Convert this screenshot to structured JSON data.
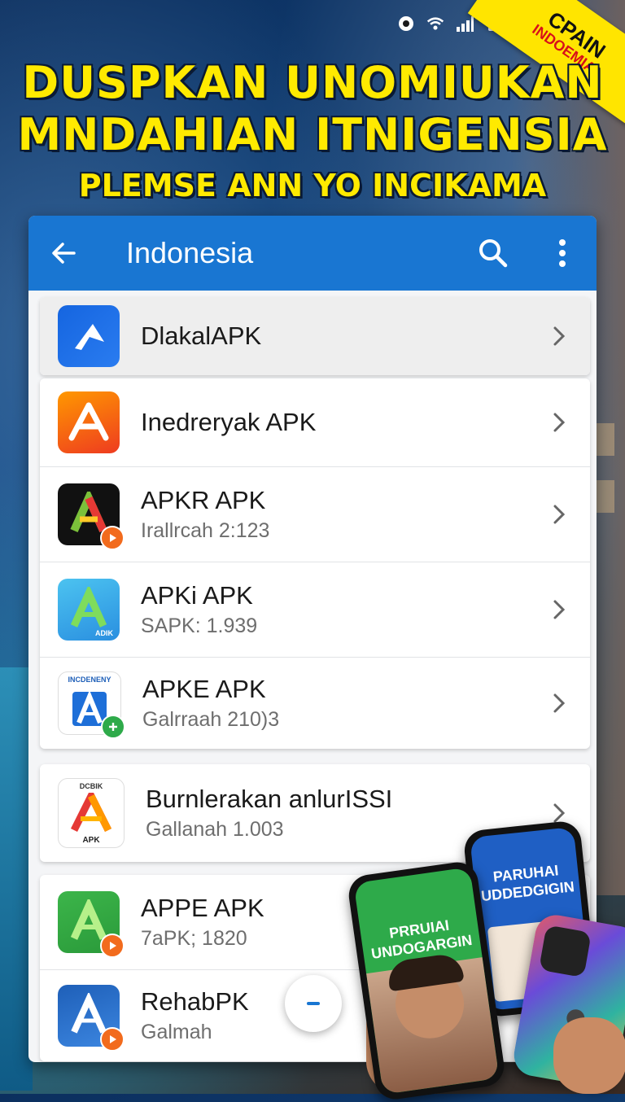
{
  "banner": {
    "corner_line1": "CPAIN",
    "corner_line2": "INDOEMIA!",
    "headline_line1": "DUSPKAN UNOMIUKAN",
    "headline_line2": "MNDAHIAN ITNIGENSIA",
    "headline_line3": "PLEMSE ANN YO INCIKAMA"
  },
  "appbar": {
    "title": "Indonesia",
    "back_icon": "arrow-left-icon",
    "search_icon": "search-icon",
    "more_icon": "more-vert-icon",
    "color": "#1976d2"
  },
  "apps": [
    {
      "name": "DlakalAPK",
      "sub": "",
      "colors": [
        "#1565e0",
        "#2a7cf0"
      ],
      "selected": true
    },
    {
      "name": "Inedreryak APK",
      "sub": "",
      "colors": [
        "#ff9800",
        "#ee3b20"
      ],
      "selected": false
    },
    {
      "name": "APKR APK",
      "sub": "Irallrcah 2:123",
      "colors": [
        "#1b1b1b",
        "#000000"
      ],
      "selected": false
    },
    {
      "name": "APKi APK",
      "sub": "SAPK: 1.939",
      "colors": [
        "#3bb3ea",
        "#2a8fe0"
      ],
      "selected": false
    },
    {
      "name": "APKE APK",
      "sub": "Galrraah 210)3",
      "colors": [
        "#ffffff",
        "#eeeeee"
      ],
      "selected": false
    },
    {
      "name": "Burnlerakan anlurISSI",
      "sub": "Gallanah 1.003",
      "colors": [
        "#ffffff",
        "#f1f1f1"
      ],
      "selected": false
    },
    {
      "name": "APPE APK",
      "sub": "7aPK; 1820",
      "colors": [
        "#3cb54a",
        "#2a9a3a"
      ],
      "selected": false
    },
    {
      "name": "RehabPK",
      "sub": "Galmah",
      "colors": [
        "#1e5fb8",
        "#3c86e0"
      ],
      "selected": false
    }
  ],
  "icon_labels": {
    "apke_top": "INCDENENY",
    "burn_top": "DCBIK",
    "burn_bottom": "APK",
    "apki_bottom": "ADIK"
  },
  "phones": {
    "left_screen": "PRRUIAI UNDOGARGIN",
    "middle_screen": "PARUHAI UDDEDGIGIN"
  }
}
